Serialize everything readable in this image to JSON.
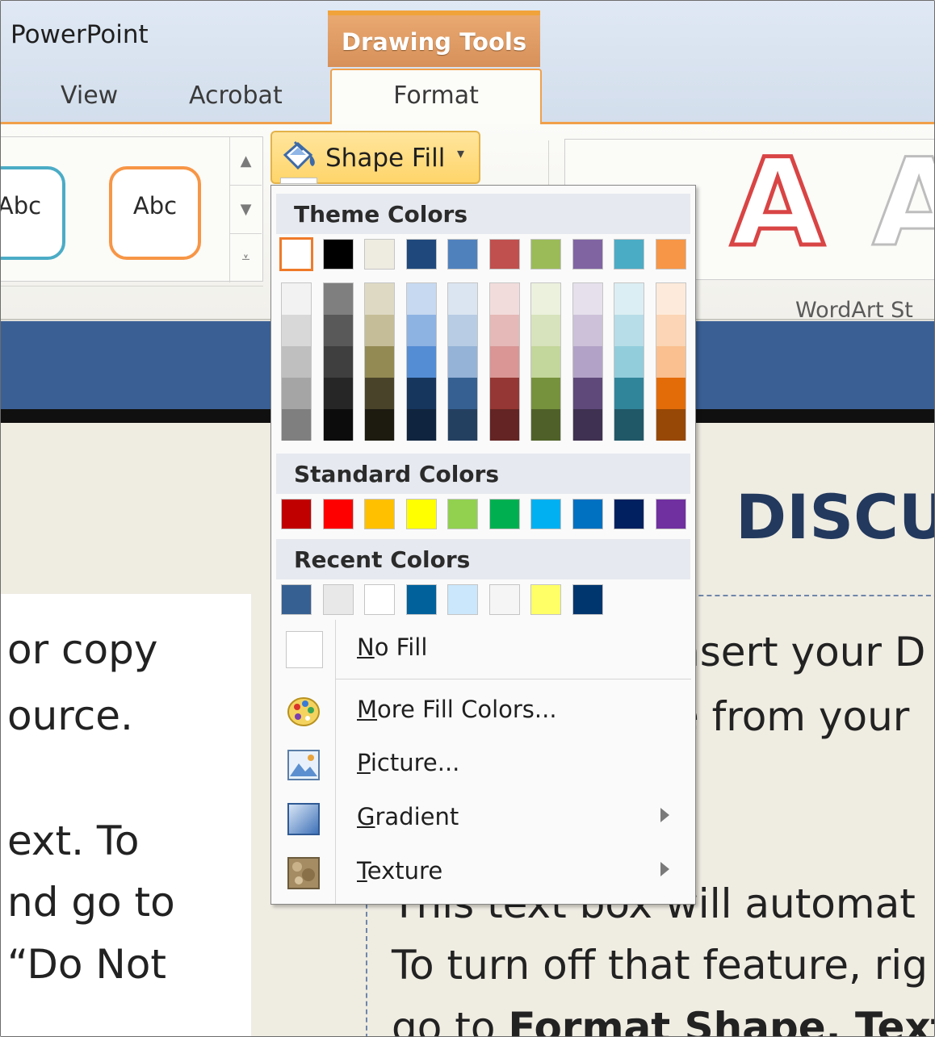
{
  "titlebar": {
    "app_title": "PowerPoint",
    "context_group": "Drawing Tools",
    "tabs": [
      {
        "label": "View"
      },
      {
        "label": "Acrobat"
      },
      {
        "label": "Format",
        "active": true
      }
    ]
  },
  "ribbon": {
    "shape_styles": [
      {
        "label": "Abc",
        "border_color": "#4bacc6"
      },
      {
        "label": "Abc",
        "border_color": "#f79646"
      }
    ],
    "shape_fill": {
      "label": "Shape Fill",
      "arrow": "▾"
    },
    "wordart": {
      "letters": [
        "A",
        "A"
      ],
      "group_label": "WordArt St"
    }
  },
  "dropdown": {
    "theme_colors_header": "Theme Colors",
    "theme_colors": [
      "#ffffff",
      "#000000",
      "#eeece1",
      "#1f497d",
      "#4f81bd",
      "#c0504d",
      "#9bbb59",
      "#8064a2",
      "#4bacc6",
      "#f79646"
    ],
    "theme_tints": [
      [
        "#f2f2f2",
        "#d8d8d8",
        "#bfbfbf",
        "#a5a5a5",
        "#7f7f7f"
      ],
      [
        "#7f7f7f",
        "#595959",
        "#3f3f3f",
        "#262626",
        "#0c0c0c"
      ],
      [
        "#ddd9c3",
        "#c4bd97",
        "#938953",
        "#494429",
        "#1d1b10"
      ],
      [
        "#c6d9f0",
        "#8db3e2",
        "#548dd4",
        "#17365d",
        "#0f243e"
      ],
      [
        "#dbe5f1",
        "#b8cce4",
        "#95b3d7",
        "#366092",
        "#244061"
      ],
      [
        "#f2dcdb",
        "#e5b9b7",
        "#d99694",
        "#953734",
        "#632423"
      ],
      [
        "#ebf1dd",
        "#d7e3bc",
        "#c3d69b",
        "#76923c",
        "#4f6128"
      ],
      [
        "#e5e0ec",
        "#ccc1d9",
        "#b2a2c7",
        "#5f497a",
        "#3f3151"
      ],
      [
        "#dbeef3",
        "#b7dde8",
        "#92cddc",
        "#31859b",
        "#205867"
      ],
      [
        "#fdeada",
        "#fbd5b5",
        "#fac08f",
        "#e36c09",
        "#974806"
      ]
    ],
    "standard_colors_header": "Standard Colors",
    "standard_colors": [
      "#c00000",
      "#ff0000",
      "#ffc000",
      "#ffff00",
      "#92d050",
      "#00b050",
      "#00b0f0",
      "#0070c0",
      "#002060",
      "#7030a0"
    ],
    "recent_colors_header": "Recent Colors",
    "recent_colors": [
      "#376092",
      "#e8e8e8",
      "#ffffff",
      "#00619b",
      "#cae7fb",
      "#f5f5f5",
      "#ffff66",
      "#00366e"
    ],
    "menu": {
      "no_fill": {
        "accel": "N",
        "rest": "o Fill"
      },
      "more_fill_colors": {
        "accel": "M",
        "rest": "ore Fill Colors..."
      },
      "picture": {
        "accel": "P",
        "rest": "icture..."
      },
      "gradient": {
        "accel": "G",
        "rest": "radient"
      },
      "texture": {
        "accel": "T",
        "rest": "exture"
      }
    }
  },
  "slide": {
    "heading": "DISCU",
    "left_lines": [
      "or copy",
      "ource.",
      "ext. To",
      "nd go to",
      " “Do Not"
    ],
    "right_lines": [
      {
        "text": "nsert your D"
      },
      {
        "text": "e from your"
      },
      {
        "text": "This text box will automat"
      },
      {
        "text": "To turn off that feature, rig"
      }
    ],
    "right_last": {
      "plain": "go to ",
      "bold": "Format Shape, Text"
    }
  }
}
